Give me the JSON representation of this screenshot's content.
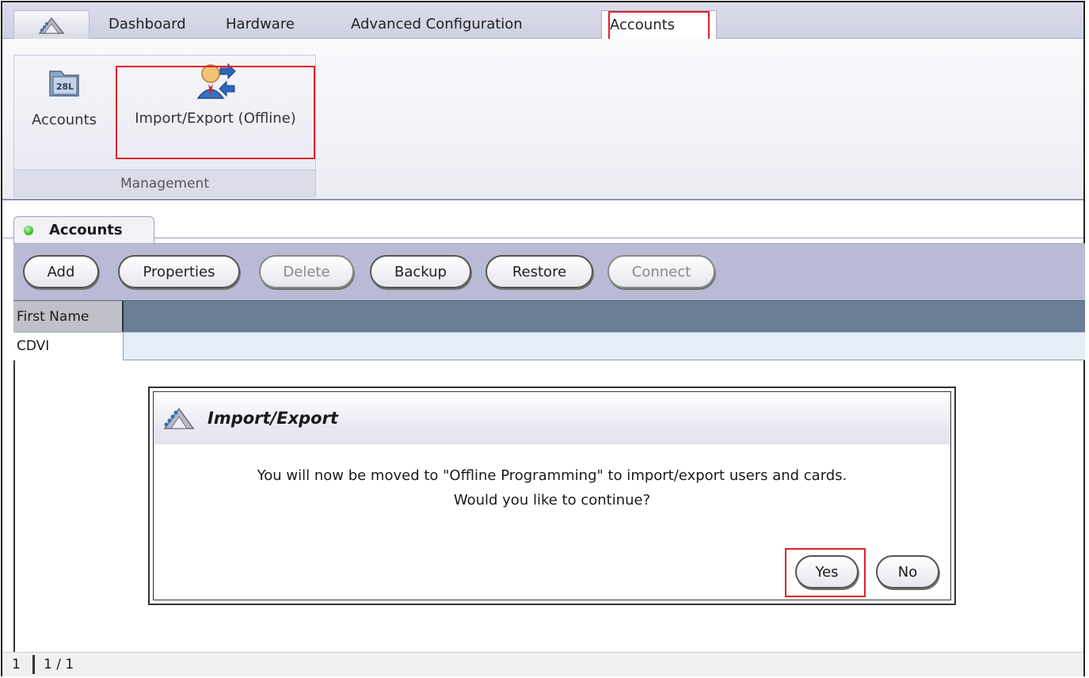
{
  "ribbon": {
    "app_icon": "cdvi-logo-icon",
    "tabs": [
      {
        "label": "Dashboard"
      },
      {
        "label": "Hardware"
      },
      {
        "label": "Advanced Configuration"
      },
      {
        "label": "Accounts",
        "active": true
      }
    ],
    "group": {
      "label": "Management",
      "buttons": [
        {
          "label": "Accounts",
          "icon": "accounts-folder-icon"
        },
        {
          "label": "Import/Export (Offline)",
          "icon": "import-export-user-icon"
        }
      ]
    }
  },
  "document_tab": {
    "label": "Accounts",
    "status_color": "#3fbf2a"
  },
  "toolbar": {
    "add": "Add",
    "properties": "Properties",
    "delete": "Delete",
    "backup": "Backup",
    "restore": "Restore",
    "connect": "Connect"
  },
  "grid": {
    "columns": [
      "First Name"
    ],
    "rows": [
      [
        "CDVI"
      ]
    ]
  },
  "status_bar": {
    "count": "1",
    "page": "1 / 1"
  },
  "dialog": {
    "title": "Import/Export",
    "line1": "You will now be moved to \"Offline Programming\" to import/export users and cards.",
    "line2": "Would you like to continue?",
    "yes": "Yes",
    "no": "No"
  },
  "colors": {
    "highlight": "#e0222a",
    "toolbar": "#b9bbd6",
    "grid_header": "#6a7e96"
  }
}
